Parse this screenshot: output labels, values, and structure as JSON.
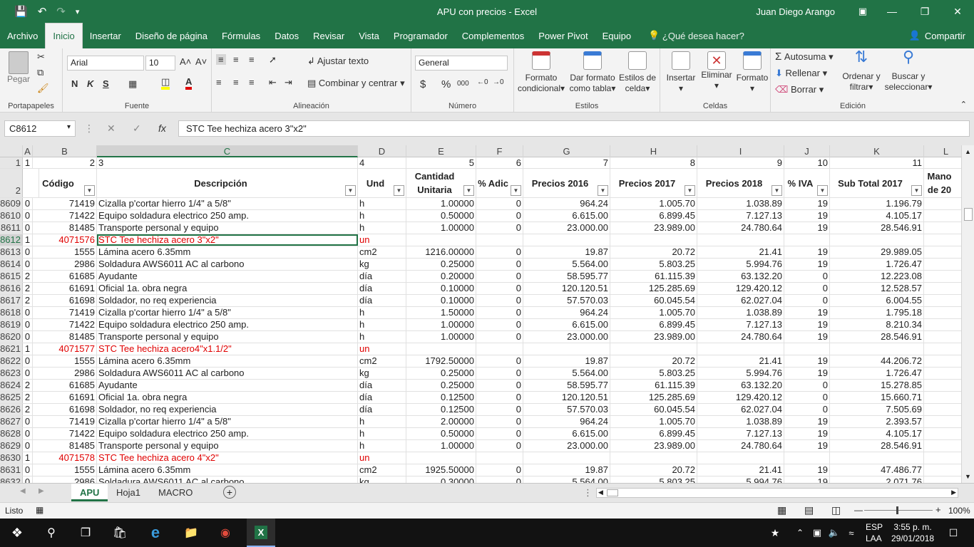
{
  "window": {
    "title": "APU con precios  -  Excel",
    "user": "Juan Diego Arango"
  },
  "menu_tabs": [
    "Archivo",
    "Inicio",
    "Insertar",
    "Diseño de página",
    "Fórmulas",
    "Datos",
    "Revisar",
    "Vista",
    "Programador",
    "Complementos",
    "Power Pivot",
    "Equipo"
  ],
  "active_tab": "Inicio",
  "tell_me": "¿Qué desea hacer?",
  "share_label": "Compartir",
  "ribbon": {
    "groups": {
      "clipboard": "Portapapeles",
      "font": "Fuente",
      "alignment": "Alineación",
      "number": "Número",
      "styles": "Estilos",
      "cells": "Celdas",
      "editing": "Edición"
    },
    "paste": "Pegar",
    "font_name": "Arial",
    "font_size": "10",
    "bold": "N",
    "italic": "K",
    "underline": "S",
    "wrap_text": "Ajustar texto",
    "merge_center": "Combinar y centrar",
    "number_format": "General",
    "currency": "$",
    "percent": "%",
    "thousands": "000",
    "cond_format": [
      "Formato",
      "condicional"
    ],
    "format_table": [
      "Dar formato",
      "como tabla"
    ],
    "cell_styles": [
      "Estilos de",
      "celda"
    ],
    "insert": "Insertar",
    "delete": "Eliminar",
    "format": "Formato",
    "autosum": "Autosuma",
    "fill": "Rellenar",
    "clear": "Borrar",
    "sort_filter": [
      "Ordenar y",
      "filtrar"
    ],
    "find_select": [
      "Buscar y",
      "seleccionar"
    ]
  },
  "formula_bar": {
    "name_box": "C8612",
    "formula": "STC Tee hechiza acero 3\"x2\""
  },
  "columns": [
    "A",
    "B",
    "C",
    "D",
    "E",
    "F",
    "G",
    "H",
    "I",
    "J",
    "K",
    "L"
  ],
  "selected_column": "C",
  "row1": {
    "num": "1",
    "cells": [
      "1",
      "2",
      "3",
      "4",
      "5",
      "6",
      "7",
      "8",
      "9",
      "10",
      "11",
      ""
    ]
  },
  "header_row": {
    "num": "2",
    "cells": [
      "",
      "Código",
      "Descripción",
      "Und",
      "Cantidad Unitaria",
      "% Adic",
      "Precios 2016",
      "Precios 2017",
      "Precios 2018",
      "% IVA",
      "Sub Total 2017",
      "Mano de 20"
    ]
  },
  "rows": [
    {
      "num": "8609",
      "a": "0",
      "b": "71419",
      "c": "Cizalla p'cortar hierro 1/4\" a 5/8\"",
      "d": "h",
      "e": "1.00000",
      "f": "0",
      "g": "964.24",
      "h": "1.005.70",
      "i": "1.038.89",
      "j": "19",
      "k": "1.196.79"
    },
    {
      "num": "8610",
      "a": "0",
      "b": "71422",
      "c": "Equipo soldadura electrico 250 amp.",
      "d": "h",
      "e": "0.50000",
      "f": "0",
      "g": "6.615.00",
      "h": "6.899.45",
      "i": "7.127.13",
      "j": "19",
      "k": "4.105.17"
    },
    {
      "num": "8611",
      "a": "0",
      "b": "81485",
      "c": "Transporte personal y equipo",
      "d": "h",
      "e": "1.00000",
      "f": "0",
      "g": "23.000.00",
      "h": "23.989.00",
      "i": "24.780.64",
      "j": "19",
      "k": "28.546.91"
    },
    {
      "num": "8612",
      "a": "1",
      "b": "4071576",
      "c": "STC Tee hechiza acero 3\"x2\"",
      "d": "un",
      "e": "",
      "f": "",
      "g": "",
      "h": "",
      "i": "",
      "j": "",
      "k": "",
      "red": true,
      "selected": true
    },
    {
      "num": "8613",
      "a": "0",
      "b": "1555",
      "c": "Lámina acero 6.35mm",
      "d": "cm2",
      "e": "1216.00000",
      "f": "0",
      "g": "19.87",
      "h": "20.72",
      "i": "21.41",
      "j": "19",
      "k": "29.989.05"
    },
    {
      "num": "8614",
      "a": "0",
      "b": "2986",
      "c": "Soldadura AWS6011 AC al carbono",
      "d": "kg",
      "e": "0.25000",
      "f": "0",
      "g": "5.564.00",
      "h": "5.803.25",
      "i": "5.994.76",
      "j": "19",
      "k": "1.726.47"
    },
    {
      "num": "8615",
      "a": "2",
      "b": "61685",
      "c": "Ayudante",
      "d": "día",
      "e": "0.20000",
      "f": "0",
      "g": "58.595.77",
      "h": "61.115.39",
      "i": "63.132.20",
      "j": "0",
      "k": "12.223.08"
    },
    {
      "num": "8616",
      "a": "2",
      "b": "61691",
      "c": "Oficial 1a. obra negra",
      "d": "día",
      "e": "0.10000",
      "f": "0",
      "g": "120.120.51",
      "h": "125.285.69",
      "i": "129.420.12",
      "j": "0",
      "k": "12.528.57"
    },
    {
      "num": "8617",
      "a": "2",
      "b": "61698",
      "c": "Soldador, no req experiencia",
      "d": "día",
      "e": "0.10000",
      "f": "0",
      "g": "57.570.03",
      "h": "60.045.54",
      "i": "62.027.04",
      "j": "0",
      "k": "6.004.55"
    },
    {
      "num": "8618",
      "a": "0",
      "b": "71419",
      "c": "Cizalla p'cortar hierro 1/4\" a 5/8\"",
      "d": "h",
      "e": "1.50000",
      "f": "0",
      "g": "964.24",
      "h": "1.005.70",
      "i": "1.038.89",
      "j": "19",
      "k": "1.795.18"
    },
    {
      "num": "8619",
      "a": "0",
      "b": "71422",
      "c": "Equipo soldadura electrico 250 amp.",
      "d": "h",
      "e": "1.00000",
      "f": "0",
      "g": "6.615.00",
      "h": "6.899.45",
      "i": "7.127.13",
      "j": "19",
      "k": "8.210.34"
    },
    {
      "num": "8620",
      "a": "0",
      "b": "81485",
      "c": "Transporte personal y equipo",
      "d": "h",
      "e": "1.00000",
      "f": "0",
      "g": "23.000.00",
      "h": "23.989.00",
      "i": "24.780.64",
      "j": "19",
      "k": "28.546.91"
    },
    {
      "num": "8621",
      "a": "1",
      "b": "4071577",
      "c": "STC Tee hechiza acero4\"x1.1/2\"",
      "d": "un",
      "e": "",
      "f": "",
      "g": "",
      "h": "",
      "i": "",
      "j": "",
      "k": "",
      "red": true
    },
    {
      "num": "8622",
      "a": "0",
      "b": "1555",
      "c": "Lámina acero 6.35mm",
      "d": "cm2",
      "e": "1792.50000",
      "f": "0",
      "g": "19.87",
      "h": "20.72",
      "i": "21.41",
      "j": "19",
      "k": "44.206.72"
    },
    {
      "num": "8623",
      "a": "0",
      "b": "2986",
      "c": "Soldadura AWS6011 AC al carbono",
      "d": "kg",
      "e": "0.25000",
      "f": "0",
      "g": "5.564.00",
      "h": "5.803.25",
      "i": "5.994.76",
      "j": "19",
      "k": "1.726.47"
    },
    {
      "num": "8624",
      "a": "2",
      "b": "61685",
      "c": "Ayudante",
      "d": "día",
      "e": "0.25000",
      "f": "0",
      "g": "58.595.77",
      "h": "61.115.39",
      "i": "63.132.20",
      "j": "0",
      "k": "15.278.85"
    },
    {
      "num": "8625",
      "a": "2",
      "b": "61691",
      "c": "Oficial 1a. obra negra",
      "d": "día",
      "e": "0.12500",
      "f": "0",
      "g": "120.120.51",
      "h": "125.285.69",
      "i": "129.420.12",
      "j": "0",
      "k": "15.660.71"
    },
    {
      "num": "8626",
      "a": "2",
      "b": "61698",
      "c": "Soldador, no req experiencia",
      "d": "día",
      "e": "0.12500",
      "f": "0",
      "g": "57.570.03",
      "h": "60.045.54",
      "i": "62.027.04",
      "j": "0",
      "k": "7.505.69"
    },
    {
      "num": "8627",
      "a": "0",
      "b": "71419",
      "c": "Cizalla p'cortar hierro 1/4\" a 5/8\"",
      "d": "h",
      "e": "2.00000",
      "f": "0",
      "g": "964.24",
      "h": "1.005.70",
      "i": "1.038.89",
      "j": "19",
      "k": "2.393.57"
    },
    {
      "num": "8628",
      "a": "0",
      "b": "71422",
      "c": "Equipo soldadura electrico 250 amp.",
      "d": "h",
      "e": "0.50000",
      "f": "0",
      "g": "6.615.00",
      "h": "6.899.45",
      "i": "7.127.13",
      "j": "19",
      "k": "4.105.17"
    },
    {
      "num": "8629",
      "a": "0",
      "b": "81485",
      "c": "Transporte personal y equipo",
      "d": "h",
      "e": "1.00000",
      "f": "0",
      "g": "23.000.00",
      "h": "23.989.00",
      "i": "24.780.64",
      "j": "19",
      "k": "28.546.91"
    },
    {
      "num": "8630",
      "a": "1",
      "b": "4071578",
      "c": "STC Tee hechiza acero 4\"x2\"",
      "d": "un",
      "e": "",
      "f": "",
      "g": "",
      "h": "",
      "i": "",
      "j": "",
      "k": "",
      "red": true
    },
    {
      "num": "8631",
      "a": "0",
      "b": "1555",
      "c": "Lámina acero 6.35mm",
      "d": "cm2",
      "e": "1925.50000",
      "f": "0",
      "g": "19.87",
      "h": "20.72",
      "i": "21.41",
      "j": "19",
      "k": "47.486.77"
    },
    {
      "num": "8632",
      "a": "0",
      "b": "2986",
      "c": "Soldadura AWS6011 AC al carbono",
      "d": "kg",
      "e": "0.30000",
      "f": "0",
      "g": "5.564.00",
      "h": "5.803.25",
      "i": "5.994.76",
      "j": "19",
      "k": "2.071.76"
    }
  ],
  "sheet_tabs": [
    "APU",
    "Hoja1",
    "MACRO"
  ],
  "active_sheet": "APU",
  "status": {
    "ready": "Listo",
    "zoom": "100%"
  },
  "taskbar": {
    "lang": "ESP",
    "lang2": "LAA",
    "time": "3:55 p. m.",
    "date": "29/01/2018"
  },
  "colors": {
    "excel_green": "#217346",
    "red_text": "#e00000"
  }
}
